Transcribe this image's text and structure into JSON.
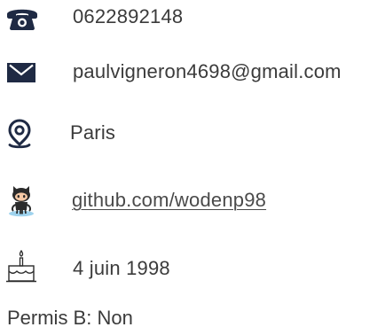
{
  "contact": {
    "phone": {
      "icon": "phone-icon",
      "text": "0622892148"
    },
    "email": {
      "icon": "envelope-icon",
      "text": "paulvigneron4698@gmail.com"
    },
    "location": {
      "icon": "map-pin-icon",
      "text": "Paris"
    },
    "github": {
      "icon": "github-octocat-icon",
      "text": "github.com/wodenp98"
    },
    "birthday": {
      "icon": "birthday-cake-icon",
      "text": "4 juin 1998"
    },
    "license": {
      "text": "Permis B: Non"
    }
  },
  "colors": {
    "icon_dark": "#1f2a44",
    "text": "#3b3b3b",
    "octocat_body": "#2b2b2b",
    "octocat_face": "#f6c9a6",
    "octocat_water": "#9fd3ee"
  }
}
